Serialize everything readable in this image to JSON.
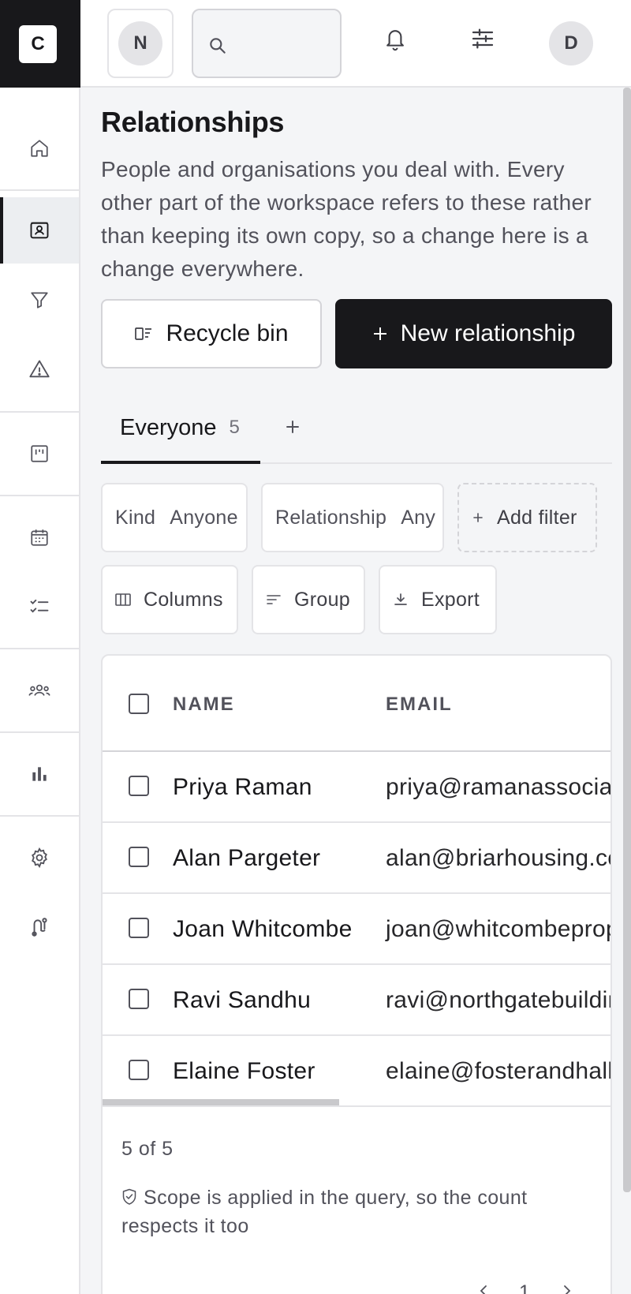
{
  "app": {
    "logo_letter": "C",
    "workspace_initial": "N",
    "user_initial": "D"
  },
  "nav": [
    {
      "icon": "home-icon"
    },
    {
      "icon": "contacts-icon",
      "active": true
    },
    {
      "icon": "funnel-icon"
    },
    {
      "icon": "alert-icon"
    },
    {
      "icon": "board-icon"
    },
    {
      "icon": "calendar-icon"
    },
    {
      "icon": "checklist-icon"
    },
    {
      "icon": "team-icon"
    },
    {
      "icon": "chart-icon"
    },
    {
      "icon": "gear-icon"
    },
    {
      "icon": "route-icon"
    }
  ],
  "header": {
    "search_placeholder": "",
    "icons": [
      "bell-icon",
      "sliders-icon"
    ]
  },
  "page": {
    "title": "Relationships",
    "description": "People and organisations you deal with. Every other part of the workspace refers to these rather than keeping its own copy, so a change here is a change everywhere.",
    "recycle_bin_label": "Recycle bin",
    "new_relationship_label": "New relationship"
  },
  "tabs": [
    {
      "label": "Everyone",
      "count": "5"
    }
  ],
  "filters": {
    "kind_label": "Kind",
    "kind_value": "Anyone",
    "relationship_label": "Relationship",
    "relationship_value": "Any",
    "add_filter_label": "Add filter"
  },
  "toolbar": {
    "columns_label": "Columns",
    "group_label": "Group",
    "export_label": "Export"
  },
  "table": {
    "columns": [
      "NAME",
      "EMAIL"
    ],
    "rows": [
      {
        "name": "Priya Raman",
        "email": "priya@ramanassociates"
      },
      {
        "name": "Alan Pargeter",
        "email": "alan@briarhousing.co."
      },
      {
        "name": "Joan Whitcombe",
        "email": "joan@whitcombeprope"
      },
      {
        "name": "Ravi Sandhu",
        "email": "ravi@northgatebuildin"
      },
      {
        "name": "Elaine Foster",
        "email": "elaine@fosterandhall.c"
      }
    ],
    "count_text": "5 of 5",
    "scope_note": "Scope is applied in the query, so the count respects it too",
    "page_number": "1"
  },
  "colors": {
    "primary": "#18181b",
    "background": "#f4f5f7",
    "border": "#e4e4e7"
  }
}
